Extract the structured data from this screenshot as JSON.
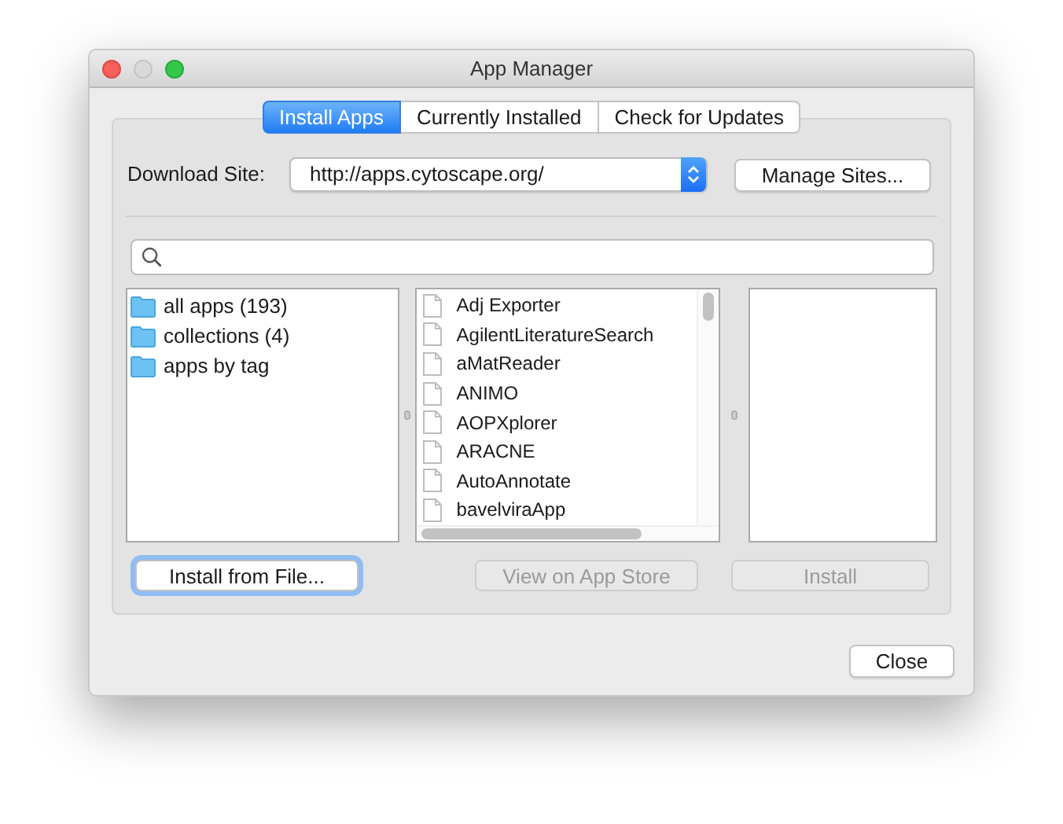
{
  "window": {
    "title": "App Manager"
  },
  "tabs": [
    {
      "label": "Install Apps",
      "selected": true
    },
    {
      "label": "Currently Installed",
      "selected": false
    },
    {
      "label": "Check for Updates",
      "selected": false
    }
  ],
  "download_site": {
    "label": "Download Site:",
    "value": "http://apps.cytoscape.org/",
    "button": "Manage Sites..."
  },
  "categories": [
    {
      "label": "all apps (193)"
    },
    {
      "label": "collections (4)"
    },
    {
      "label": "apps by tag"
    }
  ],
  "apps": [
    "Adj Exporter",
    "AgilentLiteratureSearch",
    "aMatReader",
    "ANIMO",
    "AOPXplorer",
    "ARACNE",
    "AutoAnnotate",
    "bavelviraApp"
  ],
  "actions": [
    {
      "label": "Install from File...",
      "disabled": false,
      "focused": true
    },
    {
      "label": "View on App Store",
      "disabled": true,
      "focused": false
    },
    {
      "label": "Install",
      "disabled": true,
      "focused": false
    }
  ],
  "close_button": "Close"
}
